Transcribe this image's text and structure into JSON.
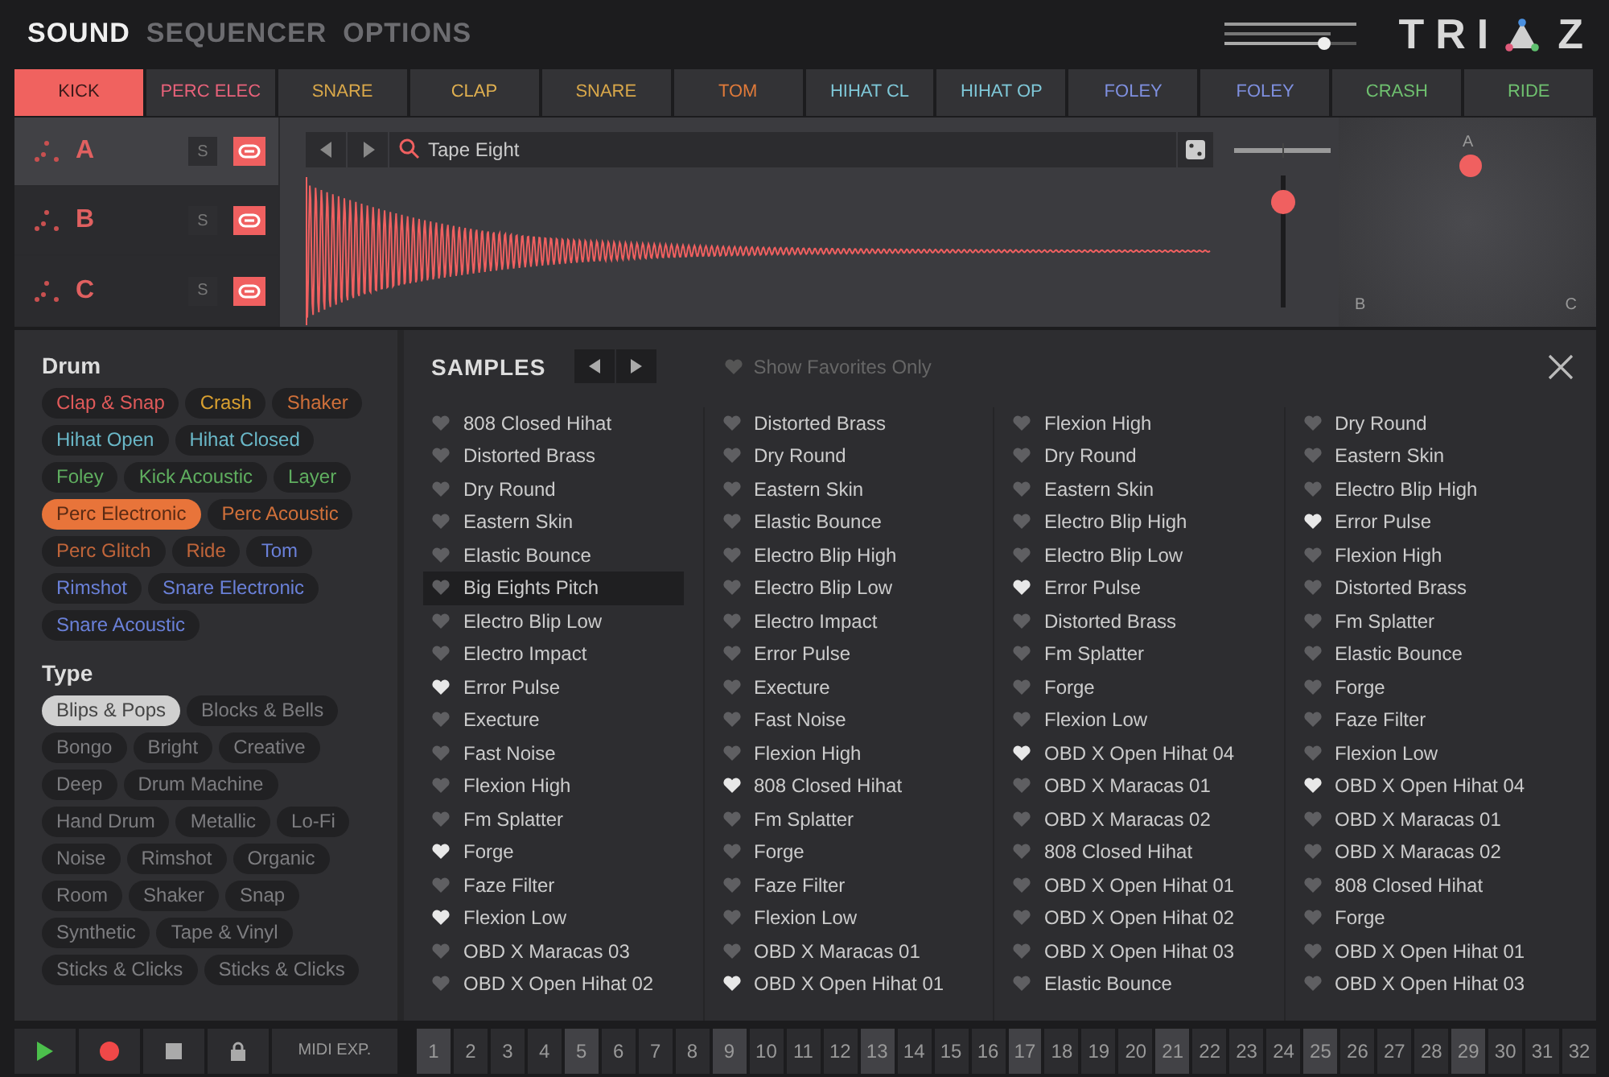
{
  "nav": [
    {
      "label": "SOUND",
      "selected": true
    },
    {
      "label": "SEQUENCER",
      "selected": false
    },
    {
      "label": "OPTIONS",
      "selected": false
    }
  ],
  "master_volume": {
    "level": 0.75
  },
  "logo": {
    "left": "TRI",
    "right": "Z"
  },
  "pads": [
    {
      "label": "KICK",
      "color": "#f0625f",
      "selected": true
    },
    {
      "label": "PERC ELEC",
      "color": "#e8627a",
      "selected": false
    },
    {
      "label": "SNARE",
      "color": "#d9a84a",
      "selected": false
    },
    {
      "label": "CLAP",
      "color": "#e0b050",
      "selected": false
    },
    {
      "label": "SNARE",
      "color": "#d9a84a",
      "selected": false
    },
    {
      "label": "TOM",
      "color": "#e07a3a",
      "selected": false
    },
    {
      "label": "HIHAT CL",
      "color": "#7fc8d8",
      "selected": false
    },
    {
      "label": "HIHAT OP",
      "color": "#7fc8d8",
      "selected": false
    },
    {
      "label": "FOLEY",
      "color": "#7f90e0",
      "selected": false
    },
    {
      "label": "FOLEY",
      "color": "#7f90e0",
      "selected": false
    },
    {
      "label": "CRASH",
      "color": "#6fc06f",
      "selected": false
    },
    {
      "label": "RIDE",
      "color": "#6fc06f",
      "selected": false
    }
  ],
  "layers": [
    {
      "label": "A",
      "selected": true,
      "solo_label": "S",
      "solo": false,
      "linked": true
    },
    {
      "label": "B",
      "selected": false,
      "solo_label": "S",
      "solo": false,
      "linked": true
    },
    {
      "label": "C",
      "selected": false,
      "solo_label": "S",
      "solo": false,
      "linked": true
    }
  ],
  "sample_search": {
    "value": "Tape Eight"
  },
  "pan": {
    "level": 0.5
  },
  "layer_volume": {
    "level": 0.8
  },
  "xy_pad": {
    "labels": [
      "A",
      "B",
      "C"
    ]
  },
  "drum_tags": {
    "title": "Drum",
    "tags": [
      {
        "label": "Clap & Snap",
        "color": "#e05a5a",
        "selected": false
      },
      {
        "label": "Crash",
        "color": "#d9a030",
        "selected": false
      },
      {
        "label": "Shaker",
        "color": "#d0703a",
        "selected": false
      },
      {
        "label": "Hihat Open",
        "color": "#6ab8c8",
        "selected": false
      },
      {
        "label": "Hihat Closed",
        "color": "#6ab8c8",
        "selected": false
      },
      {
        "label": "Foley",
        "color": "#5fae5f",
        "selected": false
      },
      {
        "label": "Kick Acoustic",
        "color": "#5fae5f",
        "selected": false
      },
      {
        "label": "Layer",
        "color": "#5fae5f",
        "selected": false
      },
      {
        "label": "Perc Electronic",
        "color": "#e8743a",
        "selected": true
      },
      {
        "label": "Perc Acoustic",
        "color": "#d0703a",
        "selected": false
      },
      {
        "label": "Perc Glitch",
        "color": "#c0653a",
        "selected": false
      },
      {
        "label": "Ride",
        "color": "#c0653a",
        "selected": false
      },
      {
        "label": "Tom",
        "color": "#6a80d8",
        "selected": false
      },
      {
        "label": "Rimshot",
        "color": "#6a80d8",
        "selected": false
      },
      {
        "label": "Snare Electronic",
        "color": "#6a80d8",
        "selected": false
      },
      {
        "label": "Snare Acoustic",
        "color": "#6a80d8",
        "selected": false
      }
    ]
  },
  "type_tags": {
    "title": "Type",
    "tags": [
      {
        "label": "Blips & Pops",
        "selected": true
      },
      {
        "label": "Blocks & Bells",
        "selected": false
      },
      {
        "label": "Bongo",
        "selected": false
      },
      {
        "label": "Bright",
        "selected": false
      },
      {
        "label": "Creative",
        "selected": false
      },
      {
        "label": "Deep",
        "selected": false
      },
      {
        "label": "Drum Machine",
        "selected": false
      },
      {
        "label": "Hand Drum",
        "selected": false
      },
      {
        "label": "Metallic",
        "selected": false
      },
      {
        "label": "Lo-Fi",
        "selected": false
      },
      {
        "label": "Noise",
        "selected": false
      },
      {
        "label": "Rimshot",
        "selected": false
      },
      {
        "label": "Organic",
        "selected": false
      },
      {
        "label": "Room",
        "selected": false
      },
      {
        "label": "Shaker",
        "selected": false
      },
      {
        "label": "Snap",
        "selected": false
      },
      {
        "label": "Synthetic",
        "selected": false
      },
      {
        "label": "Tape & Vinyl",
        "selected": false
      },
      {
        "label": "Sticks & Clicks",
        "selected": false
      },
      {
        "label": "Sticks & Clicks",
        "selected": false
      }
    ]
  },
  "samples": {
    "title": "SAMPLES",
    "favorites_filter": {
      "label": "Show Favorites Only",
      "on": false
    },
    "columns": [
      [
        {
          "name": "808 Closed Hihat",
          "favorite": false,
          "selected": false
        },
        {
          "name": "Distorted Brass",
          "favorite": false,
          "selected": false
        },
        {
          "name": "Dry Round",
          "favorite": false,
          "selected": false
        },
        {
          "name": "Eastern Skin",
          "favorite": false,
          "selected": false
        },
        {
          "name": "Elastic Bounce",
          "favorite": false,
          "selected": false
        },
        {
          "name": "Big Eights Pitch",
          "favorite": false,
          "selected": true
        },
        {
          "name": "Electro Blip Low",
          "favorite": false,
          "selected": false
        },
        {
          "name": "Electro Impact",
          "favorite": false,
          "selected": false
        },
        {
          "name": "Error Pulse",
          "favorite": true,
          "selected": false
        },
        {
          "name": "Execture",
          "favorite": false,
          "selected": false
        },
        {
          "name": "Fast Noise",
          "favorite": false,
          "selected": false
        },
        {
          "name": "Flexion High",
          "favorite": false,
          "selected": false
        },
        {
          "name": "Fm Splatter",
          "favorite": false,
          "selected": false
        },
        {
          "name": "Forge",
          "favorite": true,
          "selected": false
        },
        {
          "name": "Faze Filter",
          "favorite": false,
          "selected": false
        },
        {
          "name": "Flexion Low",
          "favorite": true,
          "selected": false
        },
        {
          "name": "OBD X Maracas 03",
          "favorite": false,
          "selected": false
        },
        {
          "name": "OBD X Open Hihat 02",
          "favorite": false,
          "selected": false
        }
      ],
      [
        {
          "name": "Distorted Brass",
          "favorite": false,
          "selected": false
        },
        {
          "name": "Dry Round",
          "favorite": false,
          "selected": false
        },
        {
          "name": "Eastern Skin",
          "favorite": false,
          "selected": false
        },
        {
          "name": "Elastic Bounce",
          "favorite": false,
          "selected": false
        },
        {
          "name": "Electro Blip High",
          "favorite": false,
          "selected": false
        },
        {
          "name": "Electro Blip Low",
          "favorite": false,
          "selected": false
        },
        {
          "name": "Electro Impact",
          "favorite": false,
          "selected": false
        },
        {
          "name": "Error Pulse",
          "favorite": false,
          "selected": false
        },
        {
          "name": "Execture",
          "favorite": false,
          "selected": false
        },
        {
          "name": "Fast Noise",
          "favorite": false,
          "selected": false
        },
        {
          "name": "Flexion High",
          "favorite": false,
          "selected": false
        },
        {
          "name": "808 Closed Hihat",
          "favorite": true,
          "selected": false
        },
        {
          "name": "Fm Splatter",
          "favorite": false,
          "selected": false
        },
        {
          "name": "Forge",
          "favorite": false,
          "selected": false
        },
        {
          "name": "Faze Filter",
          "favorite": false,
          "selected": false
        },
        {
          "name": "Flexion Low",
          "favorite": false,
          "selected": false
        },
        {
          "name": "OBD X Maracas 01",
          "favorite": false,
          "selected": false
        },
        {
          "name": "OBD X Open Hihat 01",
          "favorite": true,
          "selected": false
        }
      ],
      [
        {
          "name": "Flexion High",
          "favorite": false,
          "selected": false
        },
        {
          "name": "Dry Round",
          "favorite": false,
          "selected": false
        },
        {
          "name": "Eastern Skin",
          "favorite": false,
          "selected": false
        },
        {
          "name": "Electro Blip High",
          "favorite": false,
          "selected": false
        },
        {
          "name": "Electro Blip Low",
          "favorite": false,
          "selected": false
        },
        {
          "name": "Error Pulse",
          "favorite": true,
          "selected": false
        },
        {
          "name": "Distorted Brass",
          "favorite": false,
          "selected": false
        },
        {
          "name": "Fm Splatter",
          "favorite": false,
          "selected": false
        },
        {
          "name": "Forge",
          "favorite": false,
          "selected": false
        },
        {
          "name": "Flexion Low",
          "favorite": false,
          "selected": false
        },
        {
          "name": "OBD X Open Hihat 04",
          "favorite": true,
          "selected": false
        },
        {
          "name": "OBD X Maracas 01",
          "favorite": false,
          "selected": false
        },
        {
          "name": "OBD X Maracas 02",
          "favorite": false,
          "selected": false
        },
        {
          "name": "808 Closed Hihat",
          "favorite": false,
          "selected": false
        },
        {
          "name": "OBD X Open Hihat 01",
          "favorite": false,
          "selected": false
        },
        {
          "name": "OBD X Open Hihat 02",
          "favorite": false,
          "selected": false
        },
        {
          "name": "OBD X Open Hihat 03",
          "favorite": false,
          "selected": false
        },
        {
          "name": "Elastic Bounce",
          "favorite": false,
          "selected": false
        }
      ],
      [
        {
          "name": "Dry Round",
          "favorite": false,
          "selected": false
        },
        {
          "name": "Eastern Skin",
          "favorite": false,
          "selected": false
        },
        {
          "name": "Electro Blip High",
          "favorite": false,
          "selected": false
        },
        {
          "name": "Error Pulse",
          "favorite": true,
          "selected": false
        },
        {
          "name": "Flexion High",
          "favorite": false,
          "selected": false
        },
        {
          "name": "Distorted Brass",
          "favorite": false,
          "selected": false
        },
        {
          "name": "Fm Splatter",
          "favorite": false,
          "selected": false
        },
        {
          "name": "Elastic Bounce",
          "favorite": false,
          "selected": false
        },
        {
          "name": "Forge",
          "favorite": false,
          "selected": false
        },
        {
          "name": "Faze Filter",
          "favorite": false,
          "selected": false
        },
        {
          "name": "Flexion Low",
          "favorite": false,
          "selected": false
        },
        {
          "name": "OBD X Open Hihat 04",
          "favorite": true,
          "selected": false
        },
        {
          "name": "OBD X Maracas 01",
          "favorite": false,
          "selected": false
        },
        {
          "name": "OBD X Maracas 02",
          "favorite": false,
          "selected": false
        },
        {
          "name": "808 Closed Hihat",
          "favorite": false,
          "selected": false
        },
        {
          "name": "Forge",
          "favorite": false,
          "selected": false
        },
        {
          "name": "OBD X Open Hihat 01",
          "favorite": false,
          "selected": false
        },
        {
          "name": "OBD X Open Hihat 03",
          "favorite": false,
          "selected": false
        }
      ]
    ]
  },
  "footer": {
    "midi_label": "MIDI EXP.",
    "steps": [
      {
        "label": "1",
        "accent": true
      },
      {
        "label": "2",
        "accent": false
      },
      {
        "label": "3",
        "accent": false
      },
      {
        "label": "4",
        "accent": false
      },
      {
        "label": "5",
        "accent": true
      },
      {
        "label": "6",
        "accent": false
      },
      {
        "label": "7",
        "accent": false
      },
      {
        "label": "8",
        "accent": false
      },
      {
        "label": "9",
        "accent": true
      },
      {
        "label": "10",
        "accent": false
      },
      {
        "label": "11",
        "accent": false
      },
      {
        "label": "12",
        "accent": false
      },
      {
        "label": "13",
        "accent": true
      },
      {
        "label": "14",
        "accent": false
      },
      {
        "label": "15",
        "accent": false
      },
      {
        "label": "16",
        "accent": false
      },
      {
        "label": "17",
        "accent": true
      },
      {
        "label": "18",
        "accent": false
      },
      {
        "label": "19",
        "accent": false
      },
      {
        "label": "20",
        "accent": false
      },
      {
        "label": "21",
        "accent": true
      },
      {
        "label": "22",
        "accent": false
      },
      {
        "label": "23",
        "accent": false
      },
      {
        "label": "24",
        "accent": false
      },
      {
        "label": "25",
        "accent": true
      },
      {
        "label": "26",
        "accent": false
      },
      {
        "label": "27",
        "accent": false
      },
      {
        "label": "28",
        "accent": false
      },
      {
        "label": "29",
        "accent": true
      },
      {
        "label": "30",
        "accent": false
      },
      {
        "label": "31",
        "accent": false
      },
      {
        "label": "32",
        "accent": false
      }
    ]
  }
}
